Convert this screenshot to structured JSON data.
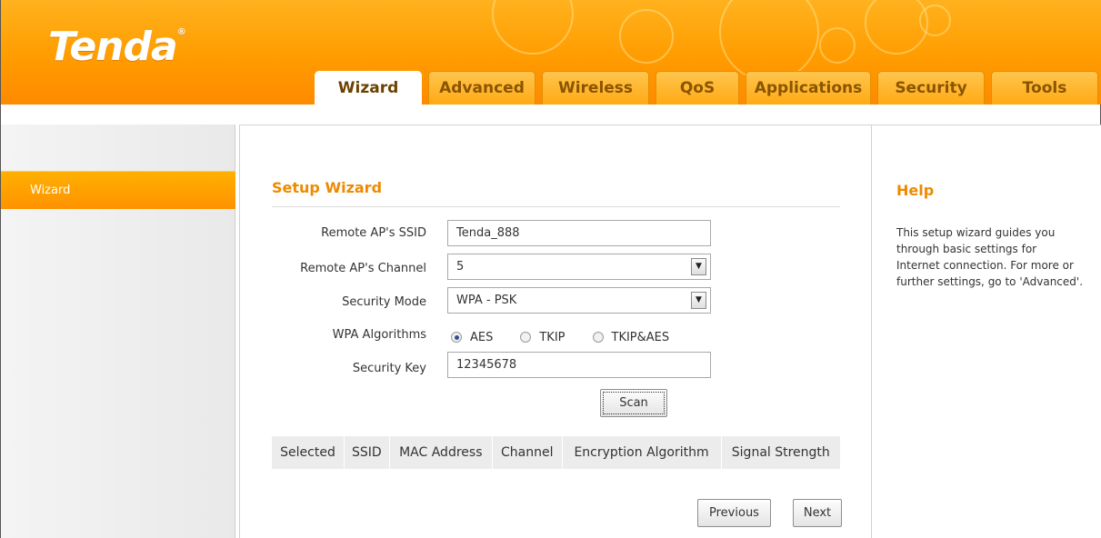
{
  "brand": {
    "logo": "Tenda",
    "trademark": "®"
  },
  "nav": {
    "tabs": [
      {
        "label": "Wizard",
        "active": true
      },
      {
        "label": "Advanced"
      },
      {
        "label": "Wireless"
      },
      {
        "label": "QoS"
      },
      {
        "label": "Applications"
      },
      {
        "label": "Security"
      },
      {
        "label": "Tools"
      }
    ]
  },
  "sidebar": {
    "items": [
      {
        "label": "Wizard",
        "selected": true
      }
    ]
  },
  "main": {
    "title": "Setup Wizard",
    "fields": {
      "ssid": {
        "label": "Remote AP's SSID",
        "value": "Tenda_888"
      },
      "channel": {
        "label": "Remote AP's Channel",
        "value": "5"
      },
      "security_mode": {
        "label": "Security Mode",
        "value": "WPA - PSK"
      },
      "wpa_algorithms": {
        "label": "WPA Algorithms",
        "options": [
          "AES",
          "TKIP",
          "TKIP&AES"
        ],
        "selected": "AES"
      },
      "security_key": {
        "label": "Security Key",
        "value": "12345678"
      }
    },
    "scan_label": "Scan",
    "table": {
      "columns": [
        "Selected",
        "SSID",
        "MAC Address",
        "Channel",
        "Encryption Algorithm",
        "Signal Strength"
      ],
      "rows": []
    },
    "previous_label": "Previous",
    "next_label": "Next"
  },
  "help": {
    "title": "Help",
    "text": "This setup wizard guides you through basic settings for Internet connection. For more or further settings, go to 'Advanced'."
  },
  "colors": {
    "accent": "#ff9c00",
    "title": "#ee8a00"
  }
}
